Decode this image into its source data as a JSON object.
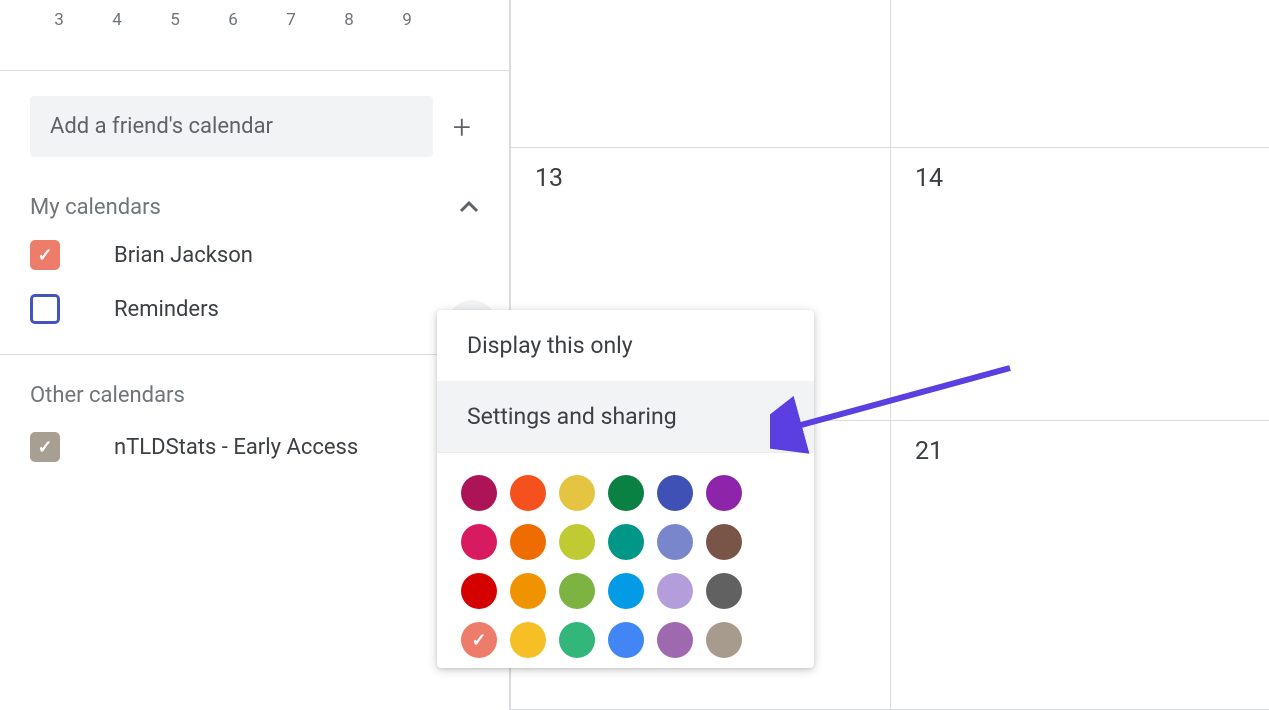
{
  "mini_calendar": {
    "days": [
      "3",
      "4",
      "5",
      "6",
      "7",
      "8",
      "9"
    ]
  },
  "add_friend": {
    "placeholder": "Add a friend's calendar"
  },
  "my_calendars": {
    "title": "My calendars",
    "items": [
      {
        "label": "Brian Jackson",
        "checked": true,
        "color": "#ee7c6b"
      },
      {
        "label": "Reminders",
        "checked": false,
        "color": "#4453c0"
      }
    ]
  },
  "other_calendars": {
    "title": "Other calendars",
    "items": [
      {
        "label": "nTLDStats - Early Access",
        "checked": true,
        "color": "#a89f93"
      }
    ]
  },
  "grid": {
    "cells": [
      "",
      "",
      "13",
      "14",
      "",
      "21"
    ]
  },
  "context_menu": {
    "display_only": "Display this only",
    "settings_sharing": "Settings and sharing",
    "colors": [
      "#ad1457",
      "#f4511e",
      "#e4c441",
      "#0b8043",
      "#3f51b5",
      "#8e24aa",
      "#d81b60",
      "#ef6c00",
      "#c0ca33",
      "#009688",
      "#7986cb",
      "#795548",
      "#d50000",
      "#f09300",
      "#7cb342",
      "#039be5",
      "#b39ddb",
      "#616161",
      "#ee7c6b",
      "#f6bf26",
      "#33b679",
      "#4285f4",
      "#9e69af",
      "#a79b8e"
    ],
    "selected_color_index": 18
  }
}
